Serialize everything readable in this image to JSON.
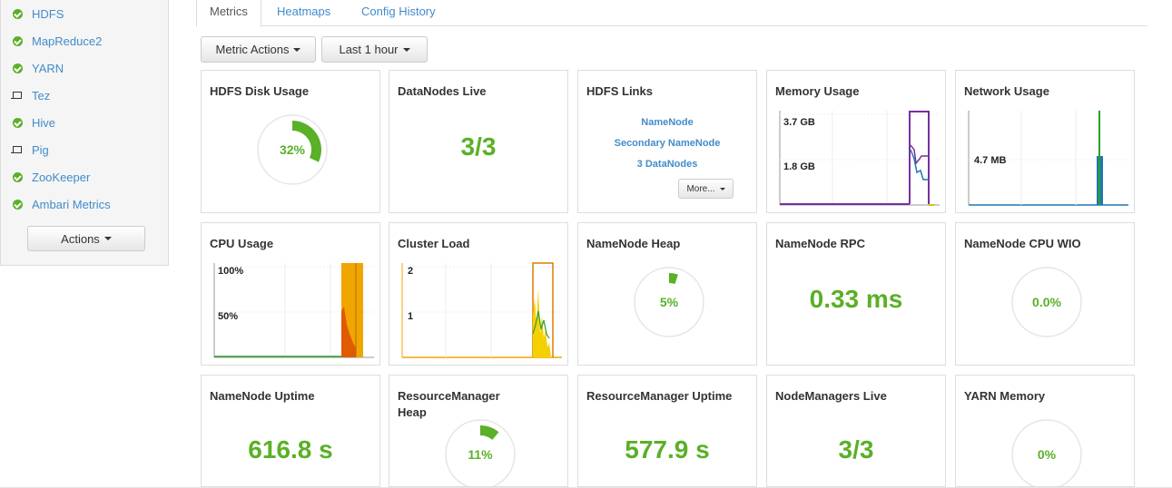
{
  "colors": {
    "accent_green": "#5ab027",
    "link_blue": "#428bca",
    "ring_gray": "#e5e5e5",
    "cpu_orange": "#f0a500",
    "cpu_dark_orange": "#e05a00",
    "memory_purple": "#7a2f9e",
    "memory_blue": "#1f77b4",
    "network_green": "#2ca02c"
  },
  "sidebar": {
    "services": [
      {
        "label": "HDFS",
        "status": "ok",
        "icon": "check-circle-icon"
      },
      {
        "label": "MapReduce2",
        "status": "ok",
        "icon": "check-circle-icon"
      },
      {
        "label": "YARN",
        "status": "ok",
        "icon": "check-circle-icon"
      },
      {
        "label": "Tez",
        "status": "client",
        "icon": "laptop-icon"
      },
      {
        "label": "Hive",
        "status": "ok",
        "icon": "check-circle-icon"
      },
      {
        "label": "Pig",
        "status": "client",
        "icon": "laptop-icon"
      },
      {
        "label": "ZooKeeper",
        "status": "ok",
        "icon": "check-circle-icon"
      },
      {
        "label": "Ambari Metrics",
        "status": "ok",
        "icon": "check-circle-icon"
      }
    ],
    "actions_label": "Actions"
  },
  "tabs": [
    {
      "label": "Metrics",
      "active": true
    },
    {
      "label": "Heatmaps",
      "active": false
    },
    {
      "label": "Config History",
      "active": false
    }
  ],
  "toolbar": {
    "metric_actions_label": "Metric Actions",
    "time_range_label": "Last 1 hour"
  },
  "widgets": {
    "hdfs_disk_usage": {
      "title": "HDFS Disk Usage",
      "value_text": "32%",
      "fraction": 0.32
    },
    "datanodes_live": {
      "title": "DataNodes Live",
      "value": "3/3"
    },
    "hdfs_links": {
      "title": "HDFS Links",
      "links": [
        "NameNode",
        "Secondary NameNode",
        "3 DataNodes"
      ],
      "more_label": "More..."
    },
    "memory_usage": {
      "title": "Memory Usage",
      "labels": [
        "3.7 GB",
        "1.8 GB"
      ]
    },
    "network_usage": {
      "title": "Network Usage",
      "labels": [
        "4.7 MB"
      ]
    },
    "cpu_usage": {
      "title": "CPU Usage",
      "labels": [
        "100%",
        "50%"
      ]
    },
    "cluster_load": {
      "title": "Cluster Load",
      "labels": [
        "2",
        "1"
      ]
    },
    "namenode_heap": {
      "title": "NameNode Heap",
      "value_text": "5%",
      "fraction": 0.05
    },
    "namenode_rpc": {
      "title": "NameNode RPC",
      "value": "0.33 ms"
    },
    "namenode_cpu_wio": {
      "title": "NameNode CPU WIO",
      "value_text": "0.0%",
      "fraction": 0.0
    },
    "namenode_uptime": {
      "title": "NameNode Uptime",
      "value": "616.8 s"
    },
    "resourcemanager_heap": {
      "title": "ResourceManager Heap",
      "value_text": "11%",
      "fraction": 0.11
    },
    "resourcemanager_uptime": {
      "title": "ResourceManager Uptime",
      "value": "577.9 s"
    },
    "nodemanagers_live": {
      "title": "NodeManagers Live",
      "value": "3/3"
    },
    "yarn_memory": {
      "title": "YARN Memory",
      "value_text": "0%",
      "fraction": 0.0
    }
  }
}
